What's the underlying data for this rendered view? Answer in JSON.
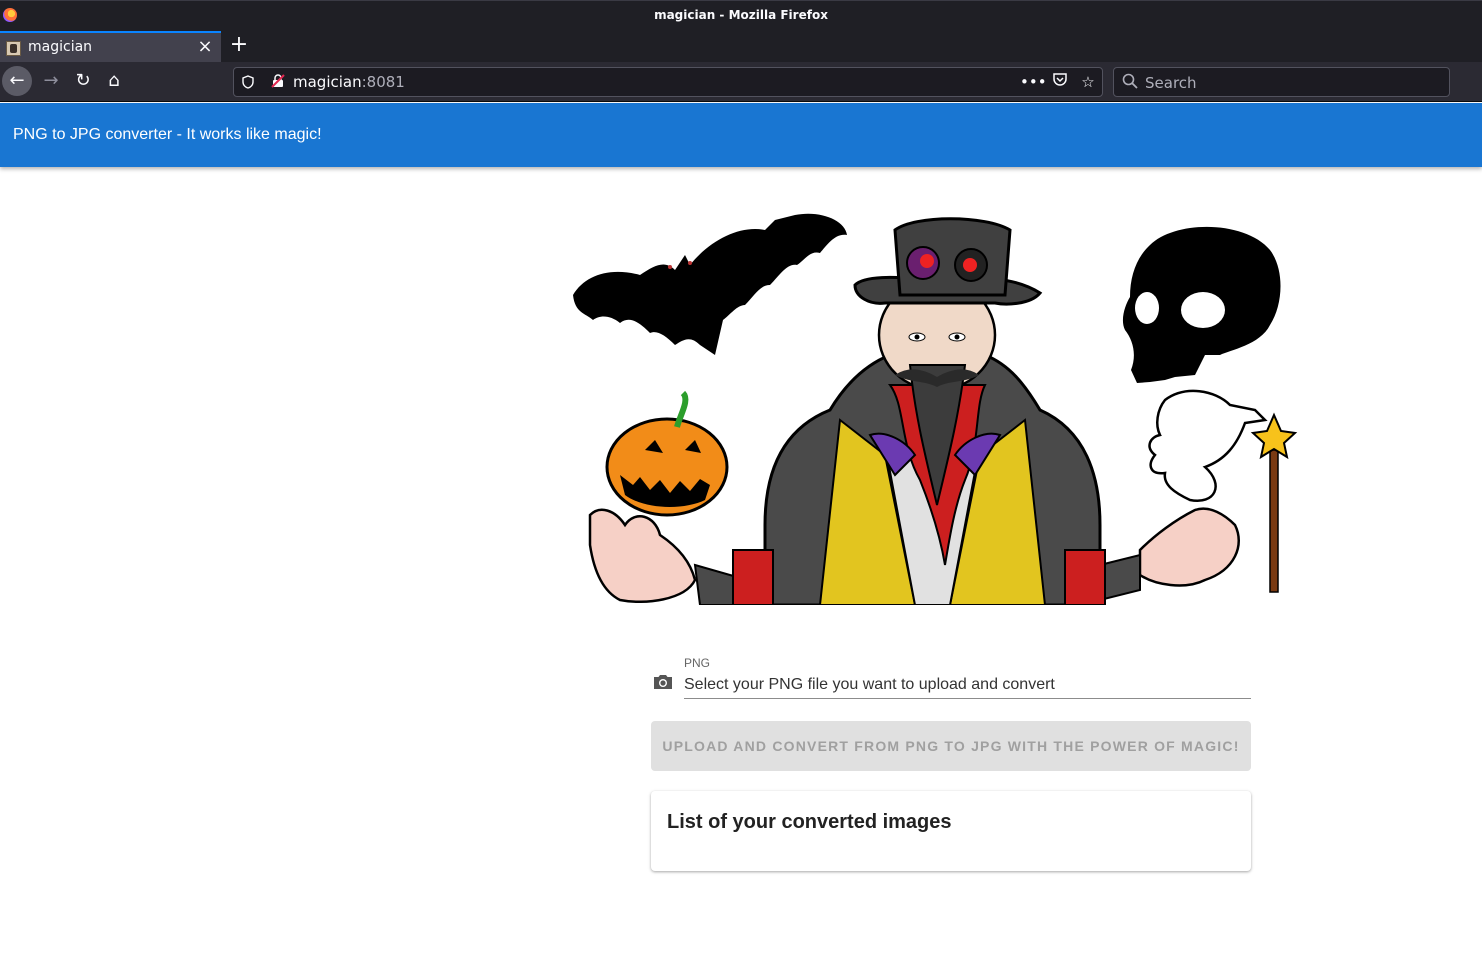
{
  "window": {
    "title": "magician - Mozilla Firefox"
  },
  "tabs": [
    {
      "label": "magician",
      "close": "×"
    }
  ],
  "toolbar": {
    "new_tab": "+",
    "back": "←",
    "forward": "→",
    "reload": "↻",
    "home": "⌂"
  },
  "urlbar": {
    "host": "magician",
    "port": ":8081",
    "icons": [
      "shield-icon",
      "insecure-lock-icon",
      "more-icon",
      "pocket-icon",
      "bookmark-star-icon"
    ]
  },
  "search": {
    "placeholder": "Search"
  },
  "app": {
    "title": "PNG to JPG converter - It works like magic!"
  },
  "form": {
    "field_label": "PNG",
    "field_placeholder": "Select your PNG file you want to upload and convert",
    "button_label": "Upload and convert from PNG to JPG with the power of magic!"
  },
  "list": {
    "title": "List of your converted images"
  },
  "colors": {
    "appbar": "#1976d2",
    "button_disabled": "#e0e0e0",
    "tab_accent": "#0a84ff"
  }
}
